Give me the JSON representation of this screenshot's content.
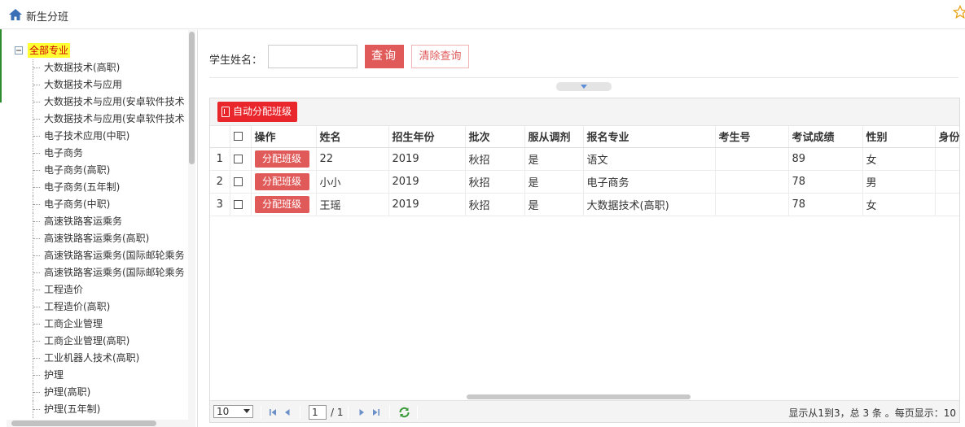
{
  "page": {
    "title": "新生分班"
  },
  "tree": {
    "root_label": "全部专业",
    "items": [
      "大数据技术(高职)",
      "大数据技术与应用",
      "大数据技术与应用(安卓软件技术",
      "大数据技术与应用(安卓软件技术",
      "电子技术应用(中职)",
      "电子商务",
      "电子商务(高职)",
      "电子商务(五年制)",
      "电子商务(中职)",
      "高速铁路客运乘务",
      "高速铁路客运乘务(高职)",
      "高速铁路客运乘务(国际邮轮乘务",
      "高速铁路客运乘务(国际邮轮乘务",
      "工程造价",
      "工程造价(高职)",
      "工商企业管理",
      "工商企业管理(高职)",
      "工业机器人技术(高职)",
      "护理",
      "护理(高职)",
      "护理(五年制)"
    ]
  },
  "search": {
    "label": "学生姓名：",
    "value": "",
    "placeholder": "",
    "query_label": "查询",
    "clear_label": "清除查询"
  },
  "toolbar": {
    "auto_assign_label": "自动分配班级"
  },
  "grid": {
    "columns": {
      "action": "操作",
      "name": "姓名",
      "year": "招生年份",
      "batch": "批次",
      "obey": "服从调剂",
      "major": "报名专业",
      "exam_no": "考生号",
      "score": "考试成绩",
      "gender": "性别",
      "idcard": "身份"
    },
    "assign_label": "分配班级",
    "rows": [
      {
        "num": "1",
        "name": "22",
        "year": "2019",
        "batch": "秋招",
        "obey": "是",
        "major": "语文",
        "exam_no": "",
        "score": "89",
        "gender": "女"
      },
      {
        "num": "2",
        "name": "小小",
        "year": "2019",
        "batch": "秋招",
        "obey": "是",
        "major": "电子商务",
        "exam_no": "",
        "score": "78",
        "gender": "男"
      },
      {
        "num": "3",
        "name": "王瑶",
        "year": "2019",
        "batch": "秋招",
        "obey": "是",
        "major": "大数据技术(高职)",
        "exam_no": "",
        "score": "78",
        "gender": "女"
      }
    ]
  },
  "pager": {
    "page_size": "10",
    "page_input": "1",
    "page_total": "/ 1",
    "info": "显示从1到3，总 3 条 。每页显示：10"
  },
  "colors": {
    "accent_red": "#e15a5a",
    "auto_button": "#e8262c",
    "tree_highlight": "#ffff33"
  }
}
